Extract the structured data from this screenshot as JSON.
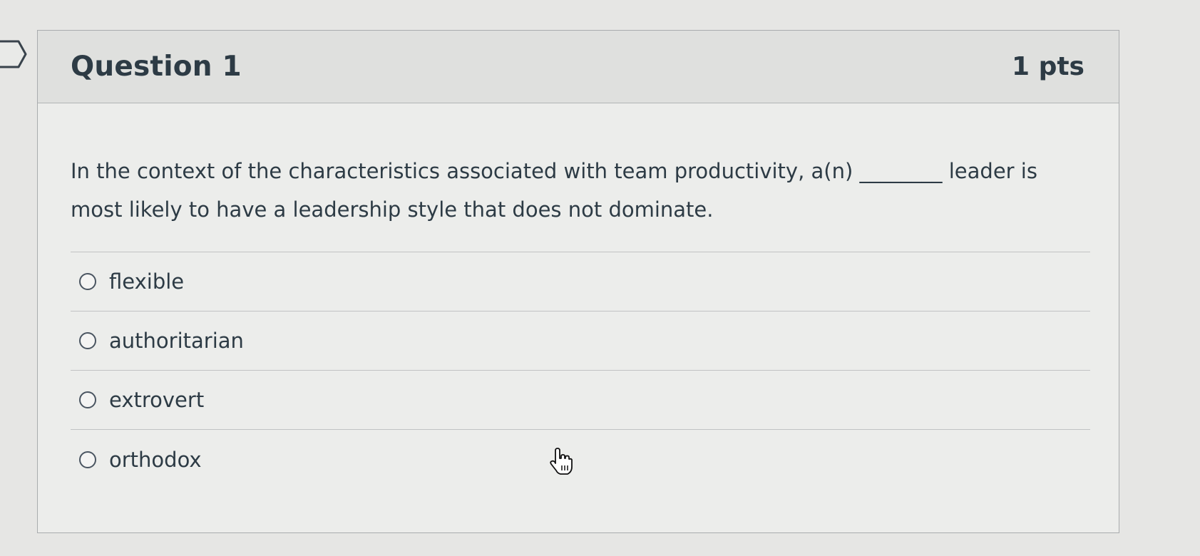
{
  "question": {
    "title": "Question 1",
    "points": "1 pts",
    "text": "In the context of the characteristics associated with team productivity, a(n) ________ leader is most likely to have a leadership style that does not dominate.",
    "answers": [
      {
        "label": "flexible"
      },
      {
        "label": "authoritarian"
      },
      {
        "label": "extrovert"
      },
      {
        "label": "orthodox"
      }
    ]
  },
  "icons": {
    "nav_flag": "question-flag-icon",
    "radio": "radio-button-icon",
    "cursor": "hand-pointer-icon"
  },
  "colors": {
    "page_background": "#e6e6e4",
    "card_background": "#ecedeb",
    "header_background": "#dfe0de",
    "text": "#2d3b45",
    "border": "#a9acae"
  }
}
